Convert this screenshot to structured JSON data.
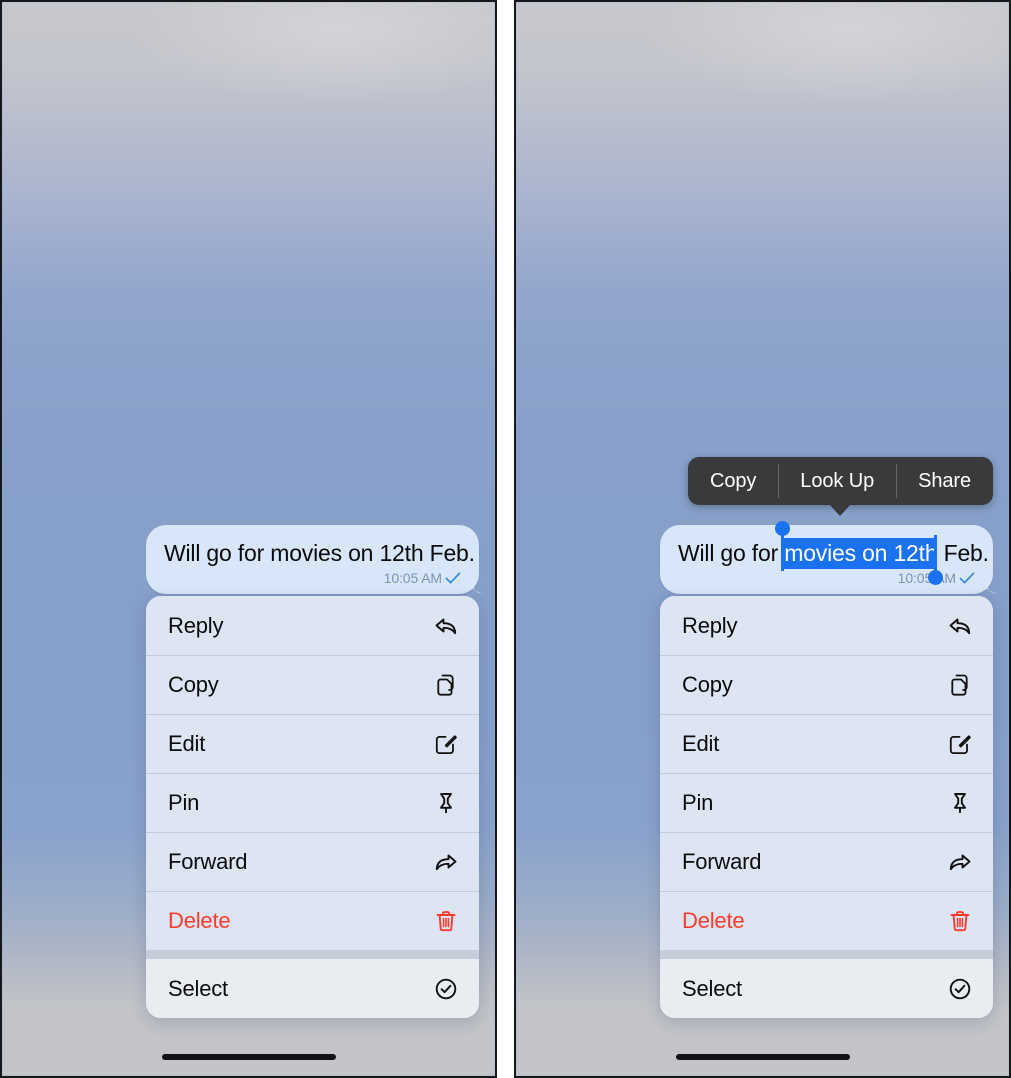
{
  "screens": [
    {
      "id": "left-panel",
      "name": "context-menu-screen",
      "message": {
        "text": "Will go for movies on 12th Feb.",
        "time": "10:05 AM",
        "status_icon": "check-icon",
        "bubble_color": "#d7e6f8"
      },
      "menu": {
        "groups": [
          {
            "items": [
              {
                "label": "Reply",
                "icon": "reply-arrow-icon",
                "danger": false
              },
              {
                "label": "Copy",
                "icon": "copy-pages-icon",
                "danger": false
              },
              {
                "label": "Edit",
                "icon": "pencil-square-icon",
                "danger": false
              },
              {
                "label": "Pin",
                "icon": "pin-icon",
                "danger": false
              },
              {
                "label": "Forward",
                "icon": "forward-arrow-icon",
                "danger": false
              },
              {
                "label": "Delete",
                "icon": "trash-icon",
                "danger": true
              }
            ]
          },
          {
            "items": [
              {
                "label": "Select",
                "icon": "check-circle-icon",
                "danger": false
              }
            ]
          }
        ]
      },
      "edit_toolbar": null,
      "selection": null
    },
    {
      "id": "right-panel",
      "name": "text-selection-screen",
      "message": {
        "text": "Will go for movies on 12th Feb.",
        "text_before": "Will go for ",
        "text_selected": "movies on 12th",
        "text_after": " Feb.",
        "time": "10:05 AM",
        "status_icon": "check-icon",
        "bubble_color": "#d7e6f8"
      },
      "selection": {
        "highlight_color": "#1a72f0",
        "handle_color": "#1a72f0",
        "start_handle": "selection-start-handle",
        "end_handle": "selection-end-handle"
      },
      "edit_toolbar": {
        "buttons": [
          "Copy",
          "Look Up",
          "Share"
        ],
        "background": "#3a3a3c"
      },
      "menu": {
        "groups": [
          {
            "items": [
              {
                "label": "Reply",
                "icon": "reply-arrow-icon",
                "danger": false
              },
              {
                "label": "Copy",
                "icon": "copy-pages-icon",
                "danger": false
              },
              {
                "label": "Edit",
                "icon": "pencil-square-icon",
                "danger": false
              },
              {
                "label": "Pin",
                "icon": "pin-icon",
                "danger": false
              },
              {
                "label": "Forward",
                "icon": "forward-arrow-icon",
                "danger": false
              },
              {
                "label": "Delete",
                "icon": "trash-icon",
                "danger": true
              }
            ]
          },
          {
            "items": [
              {
                "label": "Select",
                "icon": "check-circle-icon",
                "danger": false
              }
            ]
          }
        ]
      }
    }
  ],
  "colors": {
    "danger": "#ff3b30",
    "accent_blue": "#1a72f0",
    "bubble": "#d7e6f8",
    "menu_bg": "#e2e8f3",
    "toolbar_dark": "#3a3a3c",
    "time_text": "#7c93b5"
  }
}
